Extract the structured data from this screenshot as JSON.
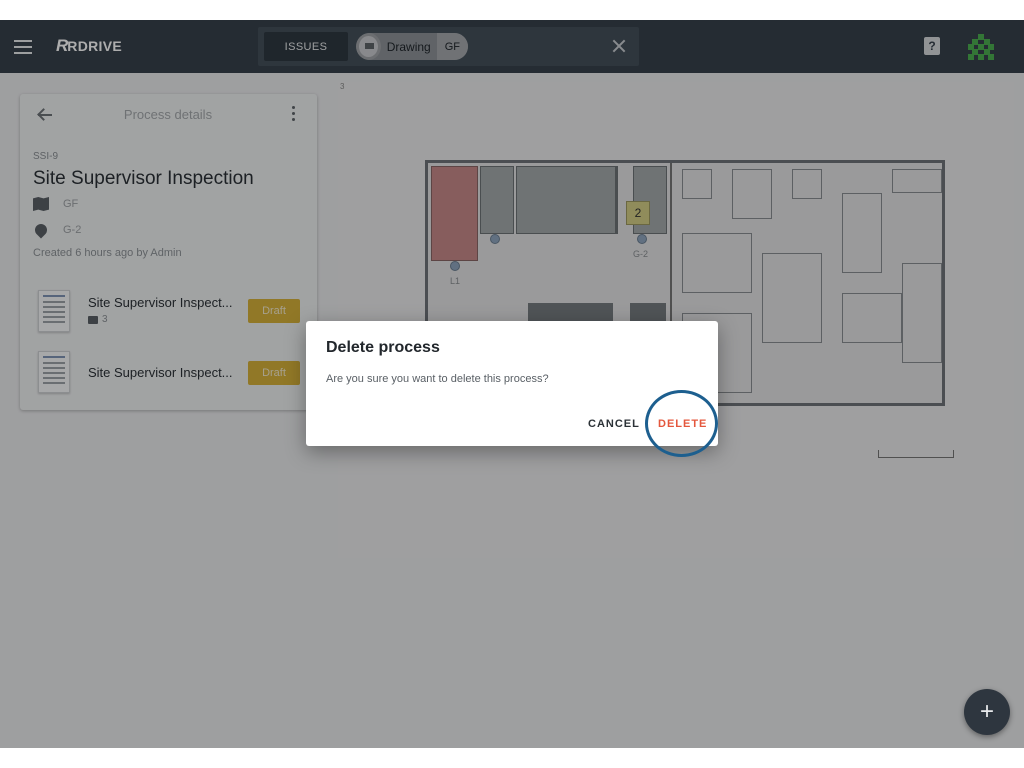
{
  "header": {
    "brand_mark": "R",
    "brand_name": "RDRIVE",
    "issues_label": "ISSUES",
    "chip_label": "Drawing",
    "chip_floor": "GF",
    "help_label": "?"
  },
  "panel": {
    "title": "Process details",
    "code": "SSI-9",
    "name": "Site Supervisor Inspection",
    "floor": "GF",
    "location": "G-2",
    "created": "Created 6 hours ago by Admin",
    "forms": [
      {
        "name": "Site Supervisor Inspect...",
        "count": "3",
        "status": "Draft"
      },
      {
        "name": "Site Supervisor Inspect...",
        "count": "",
        "status": "Draft"
      }
    ]
  },
  "drawing": {
    "corner_label": "3",
    "marker_number": "2",
    "location_labels": [
      "L1",
      "G-2"
    ]
  },
  "dialog": {
    "title": "Delete process",
    "message": "Are you sure you want to delete this process?",
    "cancel_label": "CANCEL",
    "delete_label": "DELETE"
  },
  "fab": {
    "label": "+"
  },
  "colors": {
    "topbar": "#37414c",
    "draft": "#d6b13a",
    "delete": "#e4573d",
    "highlight": "#1d5f8f"
  }
}
